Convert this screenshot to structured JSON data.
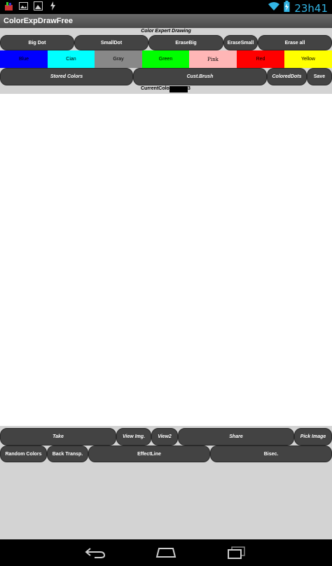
{
  "status_bar": {
    "time": "23h41",
    "left_icons": [
      "app-icon",
      "gallery-icon",
      "image-icon",
      "usb-icon"
    ],
    "right_icons": [
      "wifi-icon",
      "battery-charging-icon"
    ]
  },
  "app": {
    "title": "ColorExpDrawFree",
    "subtitle": "Color Expert Drawing"
  },
  "toolbar_top": {
    "big_dot": "Big Dot",
    "small_dot": "SmallDot",
    "erase_big": "EraseBig",
    "erase_small": "EraseSmall",
    "erase_all": "Erase all"
  },
  "colors": [
    {
      "label": "Blue",
      "color": "#0000ff"
    },
    {
      "label": "Cian",
      "color": "#00ffff"
    },
    {
      "label": "Gray",
      "color": "#888888"
    },
    {
      "label": "Green",
      "color": "#00ff00"
    },
    {
      "label": "Pink",
      "color": "#ffb6b6"
    },
    {
      "label": "Red",
      "color": "#ff0000"
    },
    {
      "label": "Yellow",
      "color": "#ffff00"
    }
  ],
  "toolbar_mid": {
    "stored_colors": "Stored Colors",
    "cust_brush": "Cust.Brush",
    "colored_dots": "ColoredDots",
    "save": "Save"
  },
  "current_color": {
    "label": "CurrentColor",
    "value": "3",
    "swatch": "#000000"
  },
  "toolbar_bottom": {
    "take": "Take",
    "view_img": "View Img.",
    "view2": "View2",
    "share": "Share",
    "pick_image": "Pick Image",
    "random_colors": "Random Colors",
    "back_transp": "Back Transp.",
    "effect_line": "EffectLine",
    "bisec": "Bisec."
  },
  "nav_bar": {
    "icons": [
      "back-icon",
      "home-icon",
      "recent-apps-icon"
    ]
  }
}
